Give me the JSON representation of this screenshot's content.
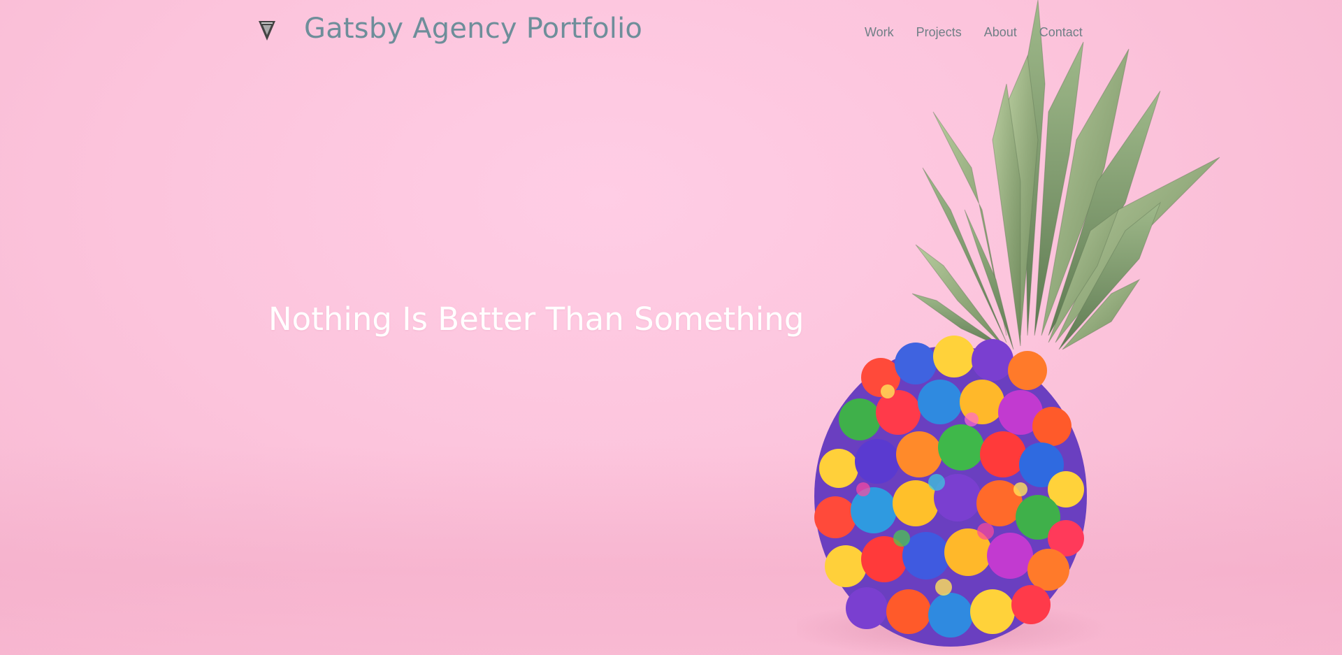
{
  "header": {
    "logo_icon": "gatsby-triangle-logo-icon",
    "title": "Gatsby Agency Portfolio"
  },
  "nav": {
    "items": [
      {
        "label": "Work"
      },
      {
        "label": "Projects"
      },
      {
        "label": "About"
      },
      {
        "label": "Contact"
      }
    ]
  },
  "hero": {
    "headline": "Nothing Is Better Than Something",
    "image_icon": "rainbow-pompom-pineapple-image"
  },
  "colors": {
    "background": "#fcc4dc",
    "title": "#6e8e9a",
    "nav": "#6f7f86",
    "headline": "#ffffff"
  }
}
